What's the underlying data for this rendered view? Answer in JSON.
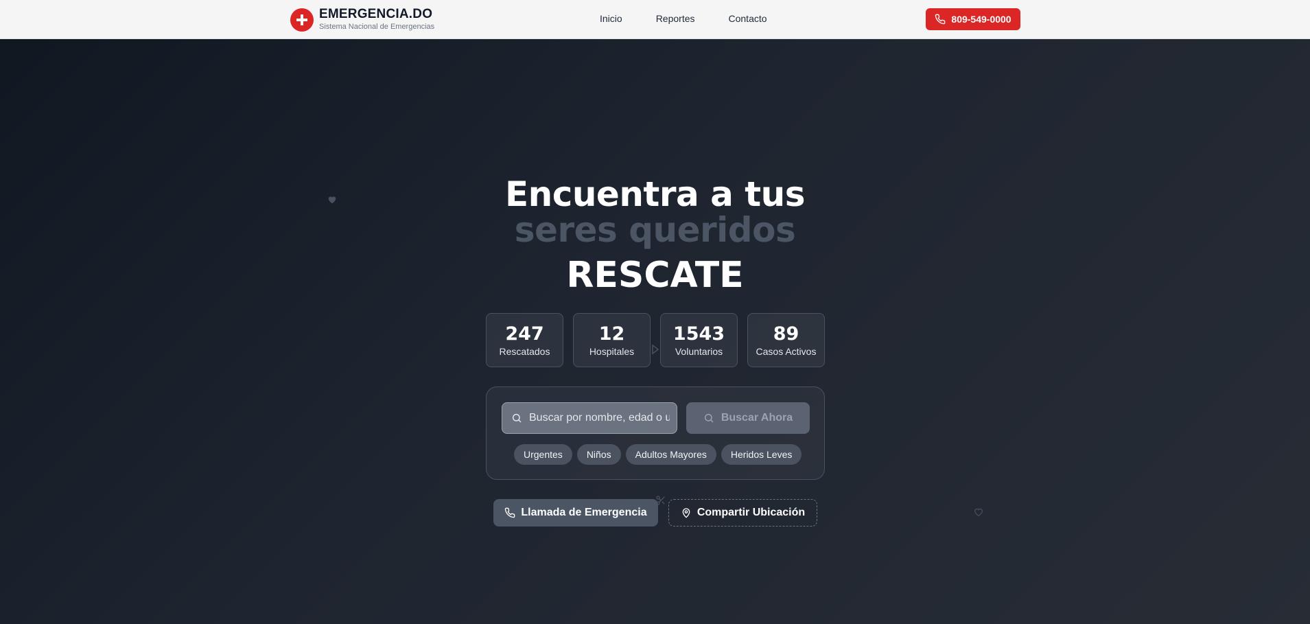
{
  "header": {
    "brand_title": "EMERGENCIA.DO",
    "brand_subtitle": "Sistema Nacional de Emergencias",
    "nav": [
      "Inicio",
      "Reportes",
      "Contacto"
    ],
    "phone": "809-549-0000"
  },
  "hero": {
    "line1": "Encuentra a tus",
    "line2": "seres queridos",
    "line3": "RESCATE"
  },
  "stats": [
    {
      "value": "247",
      "label": "Rescatados"
    },
    {
      "value": "12",
      "label": "Hospitales"
    },
    {
      "value": "1543",
      "label": "Voluntarios"
    },
    {
      "value": "89",
      "label": "Casos Activos"
    }
  ],
  "search": {
    "placeholder": "Buscar por nombre, edad o ubicación...",
    "button": "Buscar Ahora",
    "chips": [
      "Urgentes",
      "Niños",
      "Adultos Mayores",
      "Heridos Leves"
    ]
  },
  "actions": {
    "emergency_call": "Llamada de Emergencia",
    "share_location": "Compartir Ubicación"
  },
  "colors": {
    "accent": "#dc2626",
    "background": "#1f2530"
  }
}
